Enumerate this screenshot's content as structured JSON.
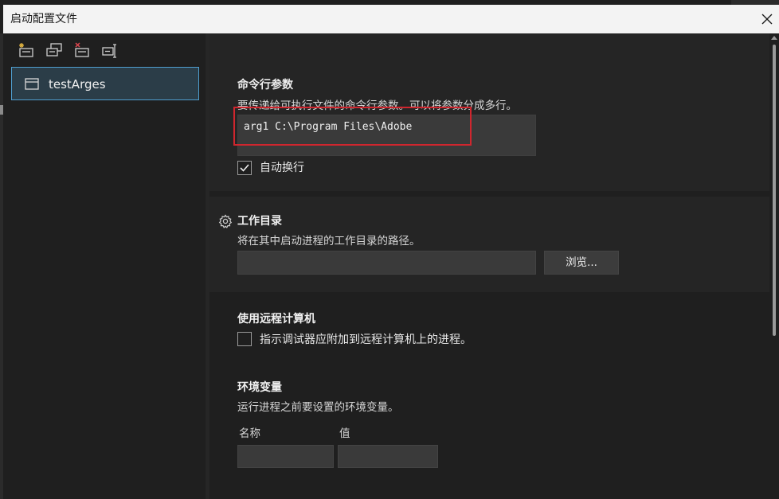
{
  "window": {
    "title": "启动配置文件",
    "close_icon": "close-icon"
  },
  "toolbar": {
    "icons": [
      "new-profile-icon",
      "duplicate-profile-icon",
      "delete-profile-icon",
      "rename-profile-icon"
    ]
  },
  "profiles": [
    {
      "label": "testArges",
      "icon": "window-icon",
      "selected": true
    }
  ],
  "sections": {
    "args": {
      "title": "命令行参数",
      "description": "要传递给可执行文件的命令行参数。可以将参数分成多行。",
      "value": "arg1 C:\\Program Files\\Adobe",
      "word_wrap_label": "自动换行",
      "word_wrap_checked": true
    },
    "workdir": {
      "title": "工作目录",
      "description": "将在其中启动进程的工作目录的路径。",
      "value": "",
      "browse_label": "浏览..."
    },
    "remote": {
      "title": "使用远程计算机",
      "checkbox_label": "指示调试器应附加到远程计算机上的进程。",
      "checked": false
    },
    "env": {
      "title": "环境变量",
      "description": "运行进程之前要设置的环境变量。",
      "col_name": "名称",
      "col_value": "值"
    }
  },
  "colors": {
    "accent_border": "#4f9fd0",
    "highlight_red": "#d0262e",
    "background": "#1f1f1f",
    "titlebar": "#f3f3f3"
  }
}
